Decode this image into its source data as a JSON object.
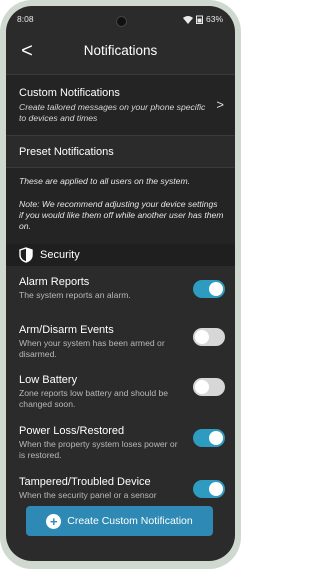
{
  "status": {
    "time": "8:08",
    "battery": "63%"
  },
  "header": {
    "title": "Notifications",
    "back": "<"
  },
  "custom": {
    "title": "Custom Notifications",
    "desc": "Create tailored messages on your phone specific to devices and times",
    "chevron": ">"
  },
  "preset": {
    "title": "Preset Notifications",
    "note1": "These are applied to all users on the system.",
    "note2": "Note: We recommend adjusting your device settings if you would like them off while another user has them on."
  },
  "section": {
    "label": "Security",
    "icon": "shield-icon"
  },
  "items": [
    {
      "title": "Alarm Reports",
      "desc": "The system reports an alarm.",
      "on": true
    },
    {
      "title": "Arm/Disarm Events",
      "desc": "When your system has been armed or disarmed.",
      "on": false
    },
    {
      "title": "Low Battery",
      "desc": "Zone reports low battery and should be changed soon.",
      "on": false
    },
    {
      "title": "Power Loss/Restored",
      "desc": "When the property system loses power or is restored.",
      "on": true
    },
    {
      "title": "Tampered/Troubled Device",
      "desc": "When the security panel or a sensor",
      "on": true
    }
  ],
  "fab": {
    "label": "Create Custom Notification",
    "icon": "plus-icon"
  },
  "colors": {
    "accent": "#2e9cc0",
    "button": "#2e8ab5",
    "background": "#2b2b2b"
  }
}
